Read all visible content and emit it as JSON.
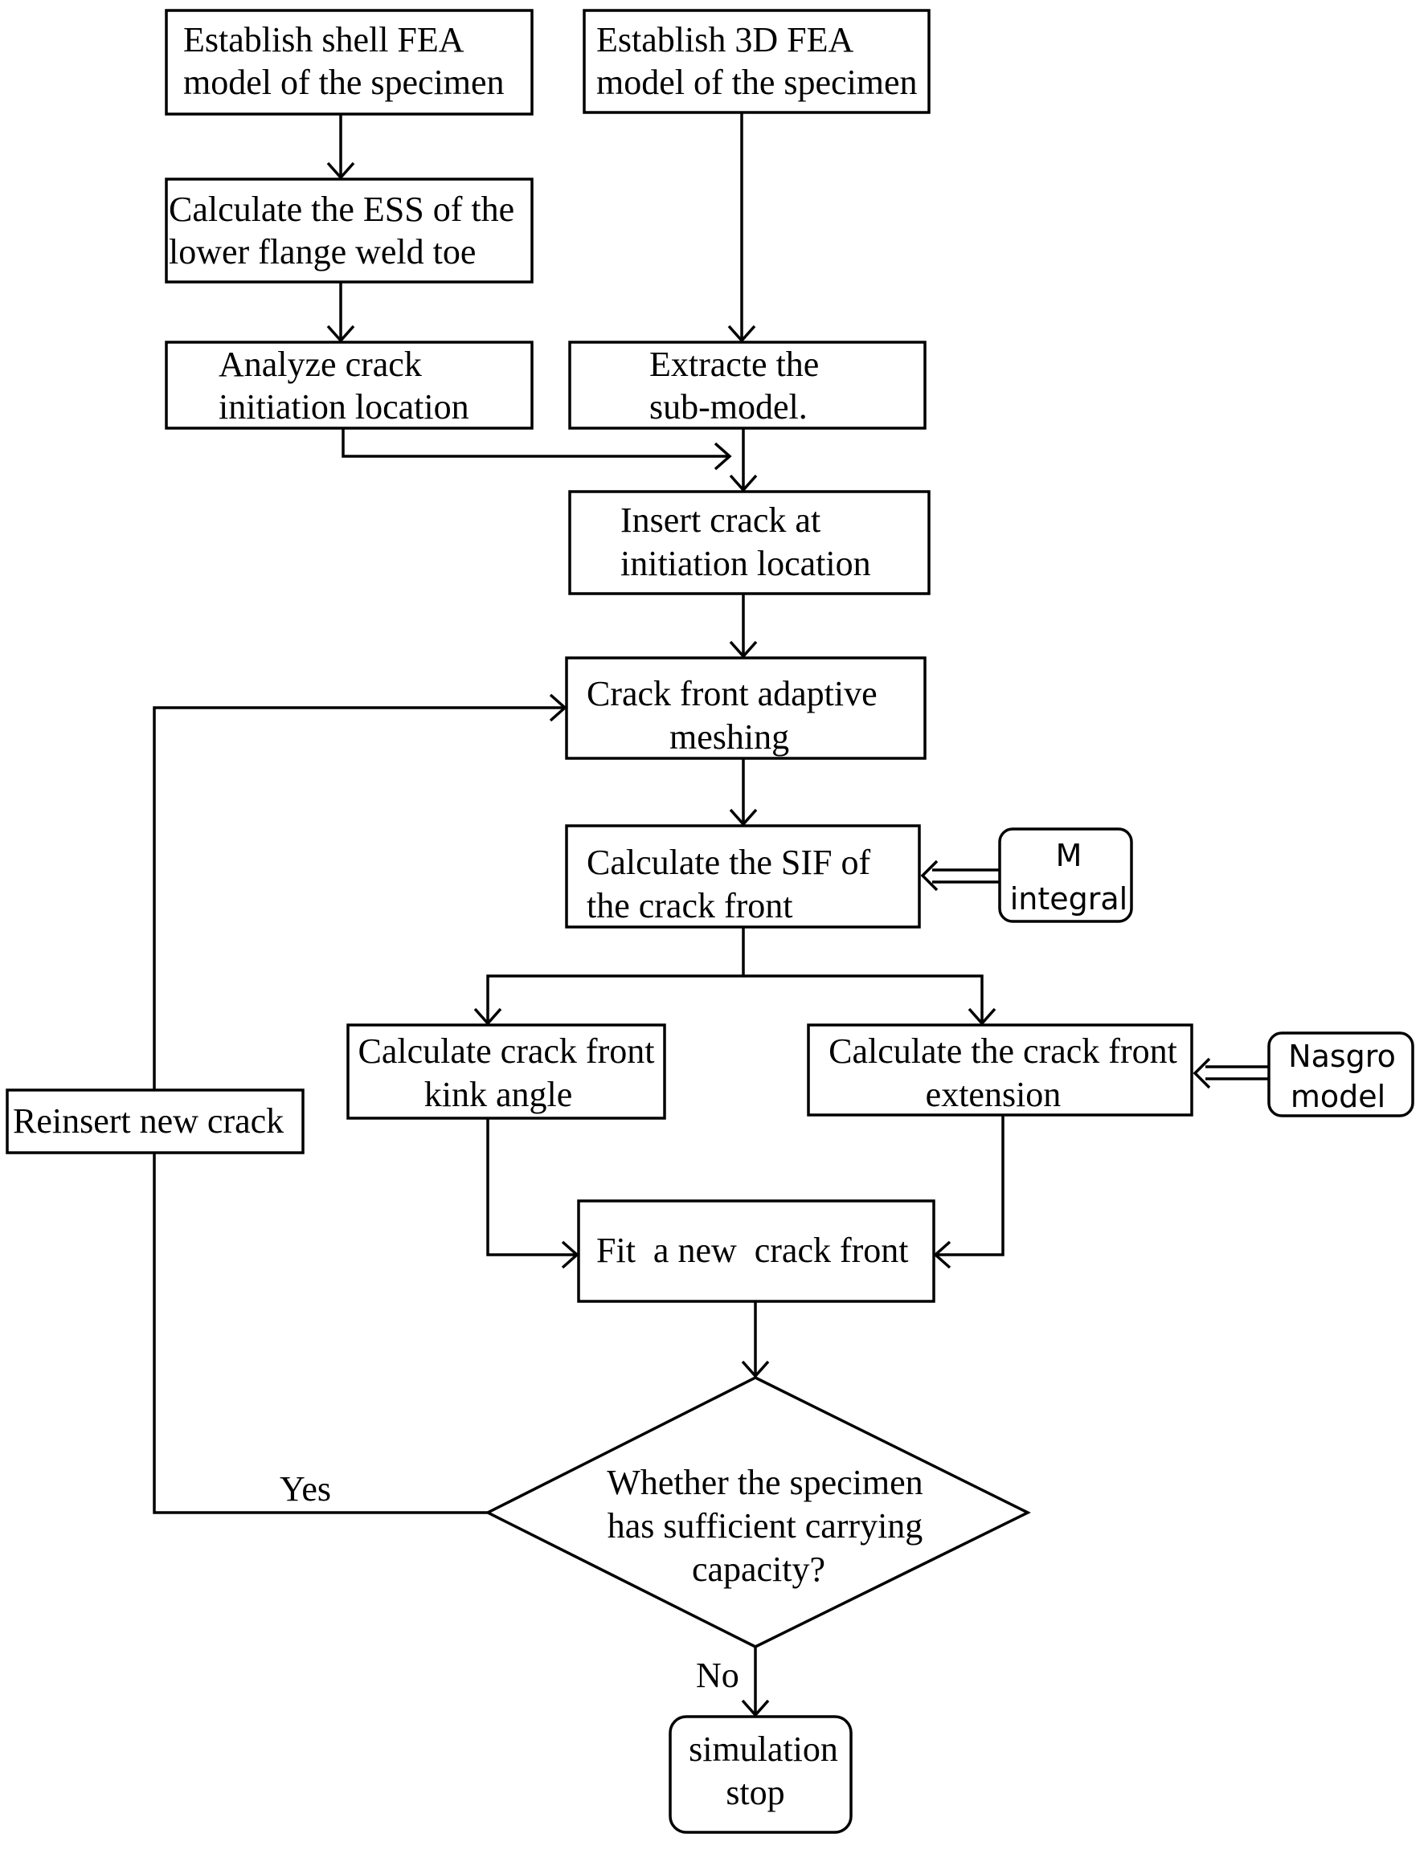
{
  "nodes": {
    "shell_fea": [
      "Establish shell FEA",
      "model of the specimen"
    ],
    "fea_3d": [
      "Establish 3D FEA",
      "model of the specimen"
    ],
    "ess": [
      "Calculate the ESS of the",
      "lower flange weld toe"
    ],
    "analyze": [
      "Analyze crack",
      "initiation location"
    ],
    "extract": [
      "Extracte the",
      "sub-model."
    ],
    "insert": [
      "Insert crack at",
      "initiation location"
    ],
    "meshing": [
      "Crack front adaptive",
      "meshing"
    ],
    "sif": [
      "Calculate the SIF of",
      "the crack front"
    ],
    "m_integral": [
      "M",
      "integral"
    ],
    "kink": [
      "Calculate crack front",
      "kink angle"
    ],
    "extension": [
      "Calculate the crack front",
      "extension"
    ],
    "nasgro": [
      "Nasgro",
      "model"
    ],
    "reinsert": [
      "Reinsert new crack"
    ],
    "fit": [
      "Fit  a new  crack front"
    ],
    "decision": [
      "Whether the specimen",
      "has sufficient carrying",
      "capacity?"
    ],
    "stop": [
      "simulation",
      "stop"
    ]
  },
  "edge_labels": {
    "yes": "Yes",
    "no": "No"
  }
}
